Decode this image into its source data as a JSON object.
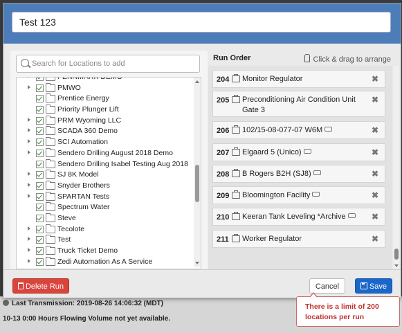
{
  "run_name": "Test 123",
  "search": {
    "placeholder": "Search for Locations to add"
  },
  "tree": {
    "partial_top": "PENNMARK DEMO",
    "items": [
      {
        "label": "PMWO",
        "expand": true
      },
      {
        "label": "Prentice Energy",
        "expand": false
      },
      {
        "label": "Priority Plunger Lift",
        "expand": false
      },
      {
        "label": "PRM Wyoming LLC",
        "expand": true
      },
      {
        "label": "SCADA 360 Demo",
        "expand": true
      },
      {
        "label": "SCI Automation",
        "expand": true
      },
      {
        "label": "Sendero Drilling August 2018 Demo",
        "expand": true
      },
      {
        "label": "Sendero Drilling Isabel Testing Aug 2018",
        "expand": false
      },
      {
        "label": "SJ 8K Model",
        "expand": true
      },
      {
        "label": "Snyder Brothers",
        "expand": true
      },
      {
        "label": "SPARTAN Tests",
        "expand": true
      },
      {
        "label": "Spectrum Water",
        "expand": false
      },
      {
        "label": "Steve",
        "expand": false
      },
      {
        "label": "Tecolote",
        "expand": true
      },
      {
        "label": "Test",
        "expand": true
      },
      {
        "label": "Truck Ticket Demo",
        "expand": true
      },
      {
        "label": "Zedi Automation As A Service",
        "expand": true
      }
    ]
  },
  "run_order": {
    "title": "Run Order",
    "hint": "Click & drag to arrange",
    "items": [
      {
        "num": "204",
        "name": "Monitor Regulator",
        "tag": false
      },
      {
        "num": "205",
        "name": "Preconditioning Air Condition Unit Gate 3",
        "tag": false
      },
      {
        "num": "206",
        "name": "102/15-08-077-07 W6M",
        "tag": true
      },
      {
        "num": "207",
        "name": "Elgaard 5 (Unico)",
        "tag": true
      },
      {
        "num": "208",
        "name": "B Rogers B2H (SJ8)",
        "tag": true
      },
      {
        "num": "209",
        "name": "Bloomington Facility",
        "tag": true
      },
      {
        "num": "210",
        "name": "Keeran Tank Leveling *Archive",
        "tag": true
      },
      {
        "num": "211",
        "name": "Worker Regulator",
        "tag": false
      }
    ],
    "remove_glyph": "✖"
  },
  "footer": {
    "delete_label": "Delete Run",
    "cancel_label": "Cancel",
    "save_label": "Save"
  },
  "tooltip": {
    "text": "There is a limit of 200 locations per run"
  },
  "background": {
    "line1": "Last Transmission: 2019-08-26 14:06:32 (MDT)",
    "line2": "10-13   0:00 Hours Flowing   Volume not yet available."
  },
  "colors": {
    "header": "#4d7db8",
    "danger": "#d9453d",
    "primary": "#1b66c9",
    "check": "#2a8a2a"
  }
}
